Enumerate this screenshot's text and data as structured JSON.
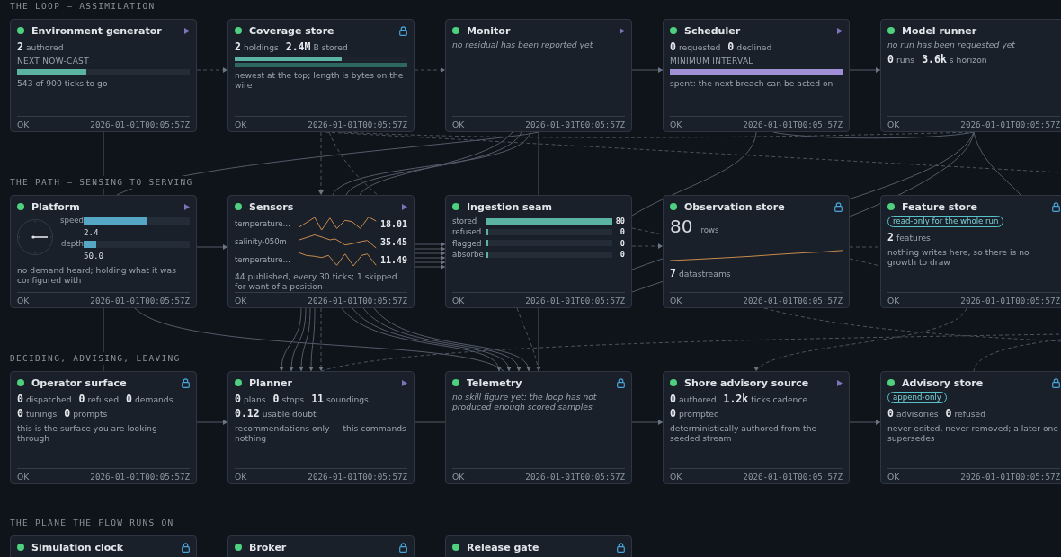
{
  "sections": [
    {
      "heading": "THE LOOP — ASSIMILATION",
      "cards": [
        {
          "title": "Environment generator",
          "healthy": true,
          "kind": "runnable",
          "body": [
            {
              "kind": "stats",
              "items": [
                {
                  "value": "2",
                  "unit": "authored"
                }
              ]
            },
            {
              "kind": "caption",
              "text": "NEXT NOW-CAST"
            },
            {
              "kind": "progress",
              "level": 0.4,
              "color": "#5bb3a4"
            },
            {
              "kind": "note",
              "text": "543 of 900 ticks to go",
              "italic": false
            }
          ],
          "footer": {
            "status": "OK",
            "time": "2026-01-01T00:05:57Z"
          }
        },
        {
          "title": "Coverage store",
          "healthy": true,
          "kind": "locked",
          "body": [
            {
              "kind": "stats",
              "items": [
                {
                  "value": "2",
                  "unit": "holdings"
                },
                {
                  "value": "2.4M",
                  "unit": "B stored"
                }
              ]
            },
            {
              "kind": "holdings",
              "bars": [
                {
                  "level": 0.62,
                  "color": "#5bb3a4"
                },
                {
                  "level": 1,
                  "color": "#2e6662"
                }
              ]
            },
            {
              "kind": "note",
              "text": "newest at the top; length is bytes on the wire",
              "italic": false
            }
          ],
          "footer": {
            "status": "OK",
            "time": "2026-01-01T00:05:57Z"
          }
        },
        {
          "title": "Monitor",
          "healthy": true,
          "kind": "runnable",
          "body": [
            {
              "kind": "note",
              "text": "no residual has been reported yet",
              "italic": true
            }
          ],
          "footer": {
            "status": "OK",
            "time": "2026-01-01T00:05:57Z"
          }
        },
        {
          "title": "Scheduler",
          "healthy": true,
          "kind": "runnable",
          "body": [
            {
              "kind": "stats",
              "items": [
                {
                  "value": "0",
                  "unit": "requested"
                },
                {
                  "value": "0",
                  "unit": "declined"
                }
              ]
            },
            {
              "kind": "caption",
              "text": "MINIMUM INTERVAL"
            },
            {
              "kind": "progress",
              "level": 1,
              "color": "#a08fd6"
            },
            {
              "kind": "note",
              "text": "spent: the next breach can be acted on",
              "italic": false
            }
          ],
          "footer": {
            "status": "OK",
            "time": "2026-01-01T00:05:57Z"
          }
        },
        {
          "title": "Model runner",
          "healthy": true,
          "kind": "plain",
          "body": [
            {
              "kind": "note",
              "text": "no run has been requested yet",
              "italic": true
            },
            {
              "kind": "stats",
              "items": [
                {
                  "value": "0",
                  "unit": "runs"
                },
                {
                  "value": "3.6k",
                  "unit": "s horizon"
                }
              ]
            }
          ],
          "footer": {
            "status": "OK",
            "time": "2026-01-01T00:05:57Z"
          }
        }
      ]
    },
    {
      "heading": "THE PATH — SENSING TO SERVING",
      "cards": [
        {
          "title": "Platform",
          "healthy": true,
          "kind": "runnable",
          "body": [
            {
              "kind": "dial",
              "gauges": [
                {
                  "label": "speed",
                  "level": 0.6,
                  "reading": "2.4"
                },
                {
                  "label": "depth",
                  "level": 0.12,
                  "reading": "50.0"
                }
              ]
            },
            {
              "kind": "note",
              "text": "no demand heard; holding what it was configured with",
              "italic": false
            }
          ],
          "footer": {
            "status": "OK",
            "time": "2026-01-01T00:05:57Z"
          }
        },
        {
          "title": "Sensors",
          "healthy": true,
          "kind": "runnable",
          "body": [
            {
              "kind": "sensors",
              "rows": [
                {
                  "label": "temperature…",
                  "reading": "18.01"
                },
                {
                  "label": "salinity-050m",
                  "reading": "35.45"
                },
                {
                  "label": "temperature…",
                  "reading": "11.49"
                }
              ]
            },
            {
              "kind": "note",
              "text": "44 published, every 30 ticks; 1 skipped for want of a position",
              "italic": false
            }
          ],
          "footer": {
            "status": "OK",
            "time": "2026-01-01T00:05:57Z"
          }
        },
        {
          "title": "Ingestion seam",
          "healthy": true,
          "kind": "plain",
          "body": [
            {
              "kind": "meters",
              "rows": [
                {
                  "label": "stored",
                  "level": 1,
                  "reading": "80"
                },
                {
                  "label": "refused",
                  "level": 0,
                  "reading": "0"
                },
                {
                  "label": "flagged",
                  "level": 0,
                  "reading": "0"
                },
                {
                  "label": "absorbe",
                  "level": 0,
                  "reading": "0"
                }
              ]
            }
          ],
          "footer": {
            "status": "OK",
            "time": "2026-01-01T00:05:57Z"
          }
        },
        {
          "title": "Observation store",
          "healthy": true,
          "kind": "locked",
          "body": [
            {
              "kind": "count",
              "value": "80",
              "unit": "rows"
            },
            {
              "kind": "trend"
            },
            {
              "kind": "stats",
              "items": [
                {
                  "value": "7",
                  "unit": "datastreams"
                }
              ]
            }
          ],
          "footer": {
            "status": "OK",
            "time": "2026-01-01T00:05:57Z"
          }
        },
        {
          "title": "Feature store",
          "healthy": true,
          "kind": "locked",
          "body": [
            {
              "kind": "badge",
              "text": "read-only for the whole run"
            },
            {
              "kind": "stats",
              "items": [
                {
                  "value": "2",
                  "unit": "features"
                }
              ]
            },
            {
              "kind": "note",
              "text": "nothing writes here, so there is no growth to draw",
              "italic": false
            }
          ],
          "footer": {
            "status": "OK",
            "time": "2026-01-01T00:05:57Z"
          }
        }
      ]
    },
    {
      "heading": "DECIDING, ADVISING, LEAVING",
      "cards": [
        {
          "title": "Operator surface",
          "healthy": true,
          "kind": "locked",
          "body": [
            {
              "kind": "stats",
              "items": [
                {
                  "value": "0",
                  "unit": "dispatched"
                },
                {
                  "value": "0",
                  "unit": "refused"
                },
                {
                  "value": "0",
                  "unit": "demands"
                },
                {
                  "value": "0",
                  "unit": "tunings"
                },
                {
                  "value": "0",
                  "unit": "prompts"
                }
              ]
            },
            {
              "kind": "note",
              "text": "this is the surface you are looking through",
              "italic": false
            }
          ],
          "footer": {
            "status": "OK",
            "time": "2026-01-01T00:05:57Z"
          }
        },
        {
          "title": "Planner",
          "healthy": true,
          "kind": "runnable",
          "body": [
            {
              "kind": "stats",
              "items": [
                {
                  "value": "0",
                  "unit": "plans"
                },
                {
                  "value": "0",
                  "unit": "stops"
                },
                {
                  "value": "11",
                  "unit": "soundings"
                },
                {
                  "value": "0.12",
                  "unit": "usable doubt"
                }
              ]
            },
            {
              "kind": "note",
              "text": "recommendations only — this commands nothing",
              "italic": false
            }
          ],
          "footer": {
            "status": "OK",
            "time": "2026-01-01T00:05:57Z"
          }
        },
        {
          "title": "Telemetry",
          "healthy": true,
          "kind": "locked",
          "body": [
            {
              "kind": "note",
              "text": "no skill figure yet: the loop has not produced enough scored samples",
              "italic": true
            }
          ],
          "footer": {
            "status": "OK",
            "time": "2026-01-01T00:05:57Z"
          }
        },
        {
          "title": "Shore advisory source",
          "healthy": true,
          "kind": "runnable",
          "body": [
            {
              "kind": "stats",
              "items": [
                {
                  "value": "0",
                  "unit": "authored"
                },
                {
                  "value": "1.2k",
                  "unit": "ticks cadence"
                },
                {
                  "value": "0",
                  "unit": "prompted"
                }
              ]
            },
            {
              "kind": "note",
              "text": "deterministically authored from the seeded stream",
              "italic": false
            }
          ],
          "footer": {
            "status": "OK",
            "time": "2026-01-01T00:05:57Z"
          }
        },
        {
          "title": "Advisory store",
          "healthy": true,
          "kind": "locked",
          "body": [
            {
              "kind": "badge",
              "text": "append-only"
            },
            {
              "kind": "stats",
              "items": [
                {
                  "value": "0",
                  "unit": "advisories"
                },
                {
                  "value": "0",
                  "unit": "refused"
                }
              ]
            },
            {
              "kind": "note",
              "text": "never edited, never removed; a later one supersedes",
              "italic": false
            }
          ],
          "footer": {
            "status": "OK",
            "time": "2026-01-01T00:05:57Z"
          }
        }
      ]
    },
    {
      "heading": "THE PLANE THE FLOW RUNS ON",
      "cards": [
        {
          "title": "Simulation clock",
          "healthy": true,
          "kind": "locked"
        },
        {
          "title": "Broker",
          "healthy": true,
          "kind": "locked"
        },
        {
          "title": "Release gate",
          "healthy": true,
          "kind": "locked"
        }
      ]
    }
  ]
}
